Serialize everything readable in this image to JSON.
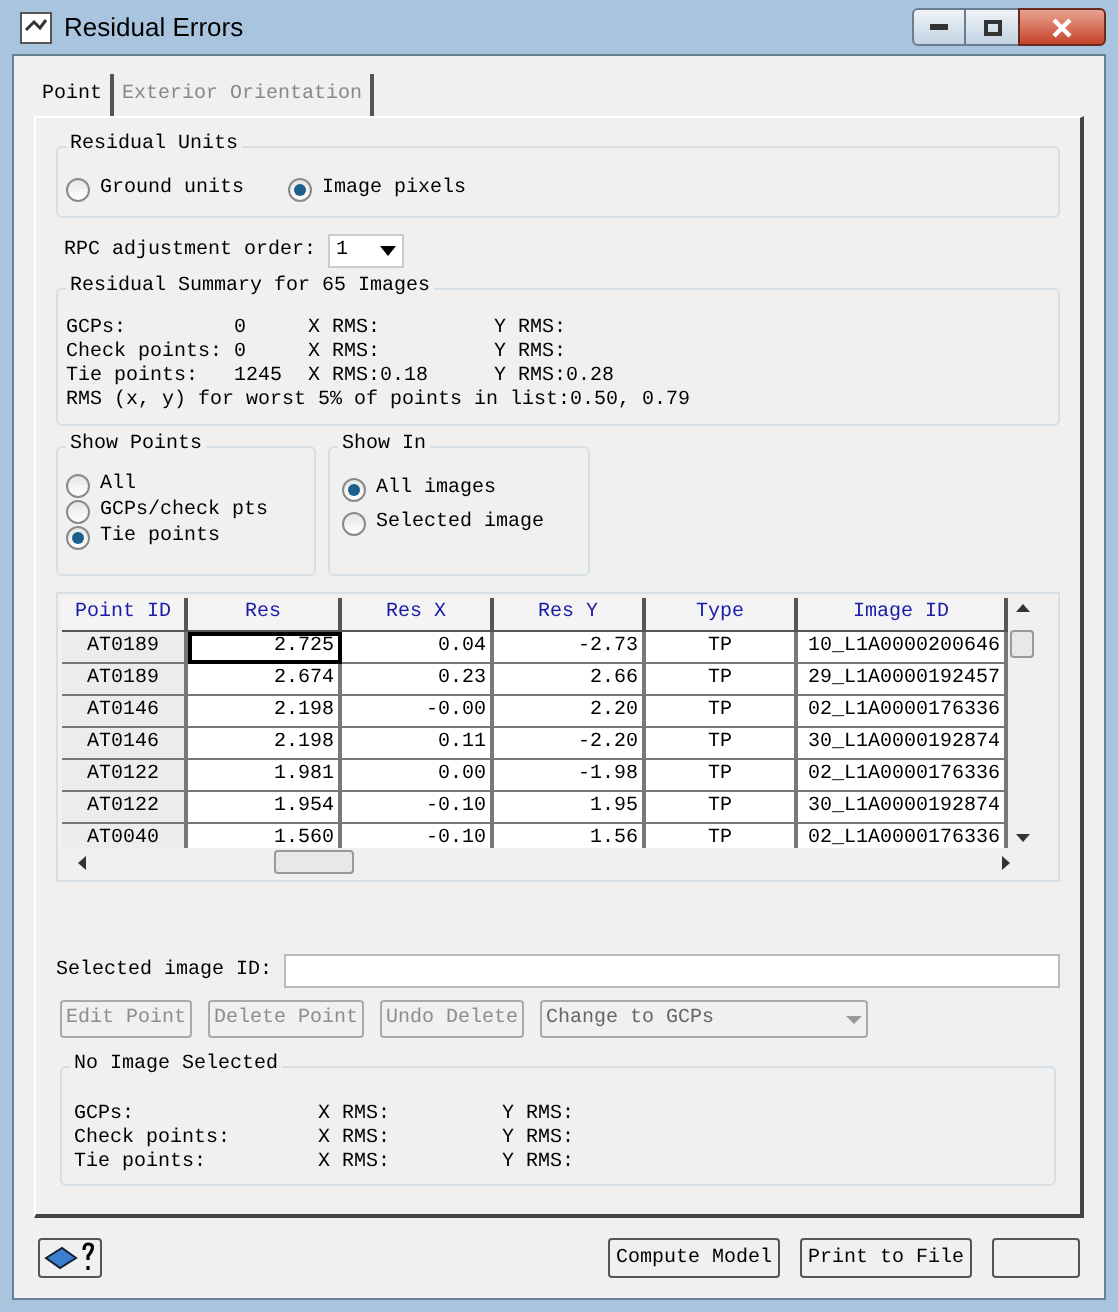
{
  "window": {
    "title": "Residual Errors"
  },
  "tabs": [
    {
      "label": "Point",
      "selected": true
    },
    {
      "label": "Exterior Orientation",
      "selected": false
    }
  ],
  "residual_units": {
    "title": "Residual Units",
    "options": [
      {
        "label": "Ground units",
        "selected": false
      },
      {
        "label": "Image pixels",
        "selected": true
      }
    ]
  },
  "rpc": {
    "label": "RPC adjustment order:",
    "value": "1"
  },
  "summary": {
    "title": "Residual Summary for 65 Images",
    "rows": [
      {
        "label": "GCPs:",
        "count": "0",
        "x_rms": "X RMS:",
        "y_rms": "Y RMS:"
      },
      {
        "label": "Check points:",
        "count": "0",
        "x_rms": "X RMS:",
        "y_rms": "Y RMS:"
      },
      {
        "label": "Tie points:",
        "count": "1245",
        "x_rms": "X RMS:0.18",
        "y_rms": "Y RMS:0.28"
      }
    ],
    "worst": "RMS (x, y) for worst 5% of points in list:0.50, 0.79"
  },
  "show_points": {
    "title": "Show Points",
    "options": [
      {
        "label": "All",
        "selected": false
      },
      {
        "label": "GCPs/check pts",
        "selected": false
      },
      {
        "label": "Tie points",
        "selected": true
      }
    ]
  },
  "show_in": {
    "title": "Show In",
    "options": [
      {
        "label": "All images",
        "selected": true
      },
      {
        "label": "Selected image",
        "selected": false
      }
    ]
  },
  "table": {
    "columns": [
      "Point ID",
      "Res",
      "Res X",
      "Res Y",
      "Type",
      "Image ID"
    ],
    "rows": [
      {
        "cells": [
          "AT0189",
          "2.725",
          "0.04",
          "-2.73",
          "TP",
          "10_L1A0000200646"
        ],
        "focused": true
      },
      {
        "cells": [
          "AT0189",
          "2.674",
          "0.23",
          "2.66",
          "TP",
          "29_L1A0000192457"
        ],
        "focused": false
      },
      {
        "cells": [
          "AT0146",
          "2.198",
          "-0.00",
          "2.20",
          "TP",
          "02_L1A0000176336"
        ],
        "focused": false
      },
      {
        "cells": [
          "AT0146",
          "2.198",
          "0.11",
          "-2.20",
          "TP",
          "30_L1A0000192874"
        ],
        "focused": false
      },
      {
        "cells": [
          "AT0122",
          "1.981",
          "0.00",
          "-1.98",
          "TP",
          "02_L1A0000176336"
        ],
        "focused": false
      },
      {
        "cells": [
          "AT0122",
          "1.954",
          "-0.10",
          "1.95",
          "TP",
          "30_L1A0000192874"
        ],
        "focused": false
      },
      {
        "cells": [
          "AT0040",
          "1.560",
          "-0.10",
          "1.56",
          "TP",
          "02_L1A0000176336"
        ],
        "focused": false
      }
    ]
  },
  "selected_image": {
    "label": "Selected image ID:"
  },
  "actions": [
    {
      "label": "Edit Point",
      "disabled": true
    },
    {
      "label": "Delete Point",
      "disabled": true
    },
    {
      "label": "Undo Delete",
      "disabled": true
    }
  ],
  "change_select": {
    "value": "Change to GCPs",
    "disabled": true
  },
  "image_summary": {
    "title": "No Image Selected",
    "rows": [
      {
        "label": "GCPs:",
        "x_rms": "X RMS:",
        "y_rms": "Y RMS:"
      },
      {
        "label": "Check points:",
        "x_rms": "X RMS:",
        "y_rms": "Y RMS:"
      },
      {
        "label": "Tie points:",
        "x_rms": "X RMS:",
        "y_rms": "Y RMS:"
      }
    ]
  },
  "footer_buttons": [
    "Compute Model",
    "Print to File"
  ]
}
